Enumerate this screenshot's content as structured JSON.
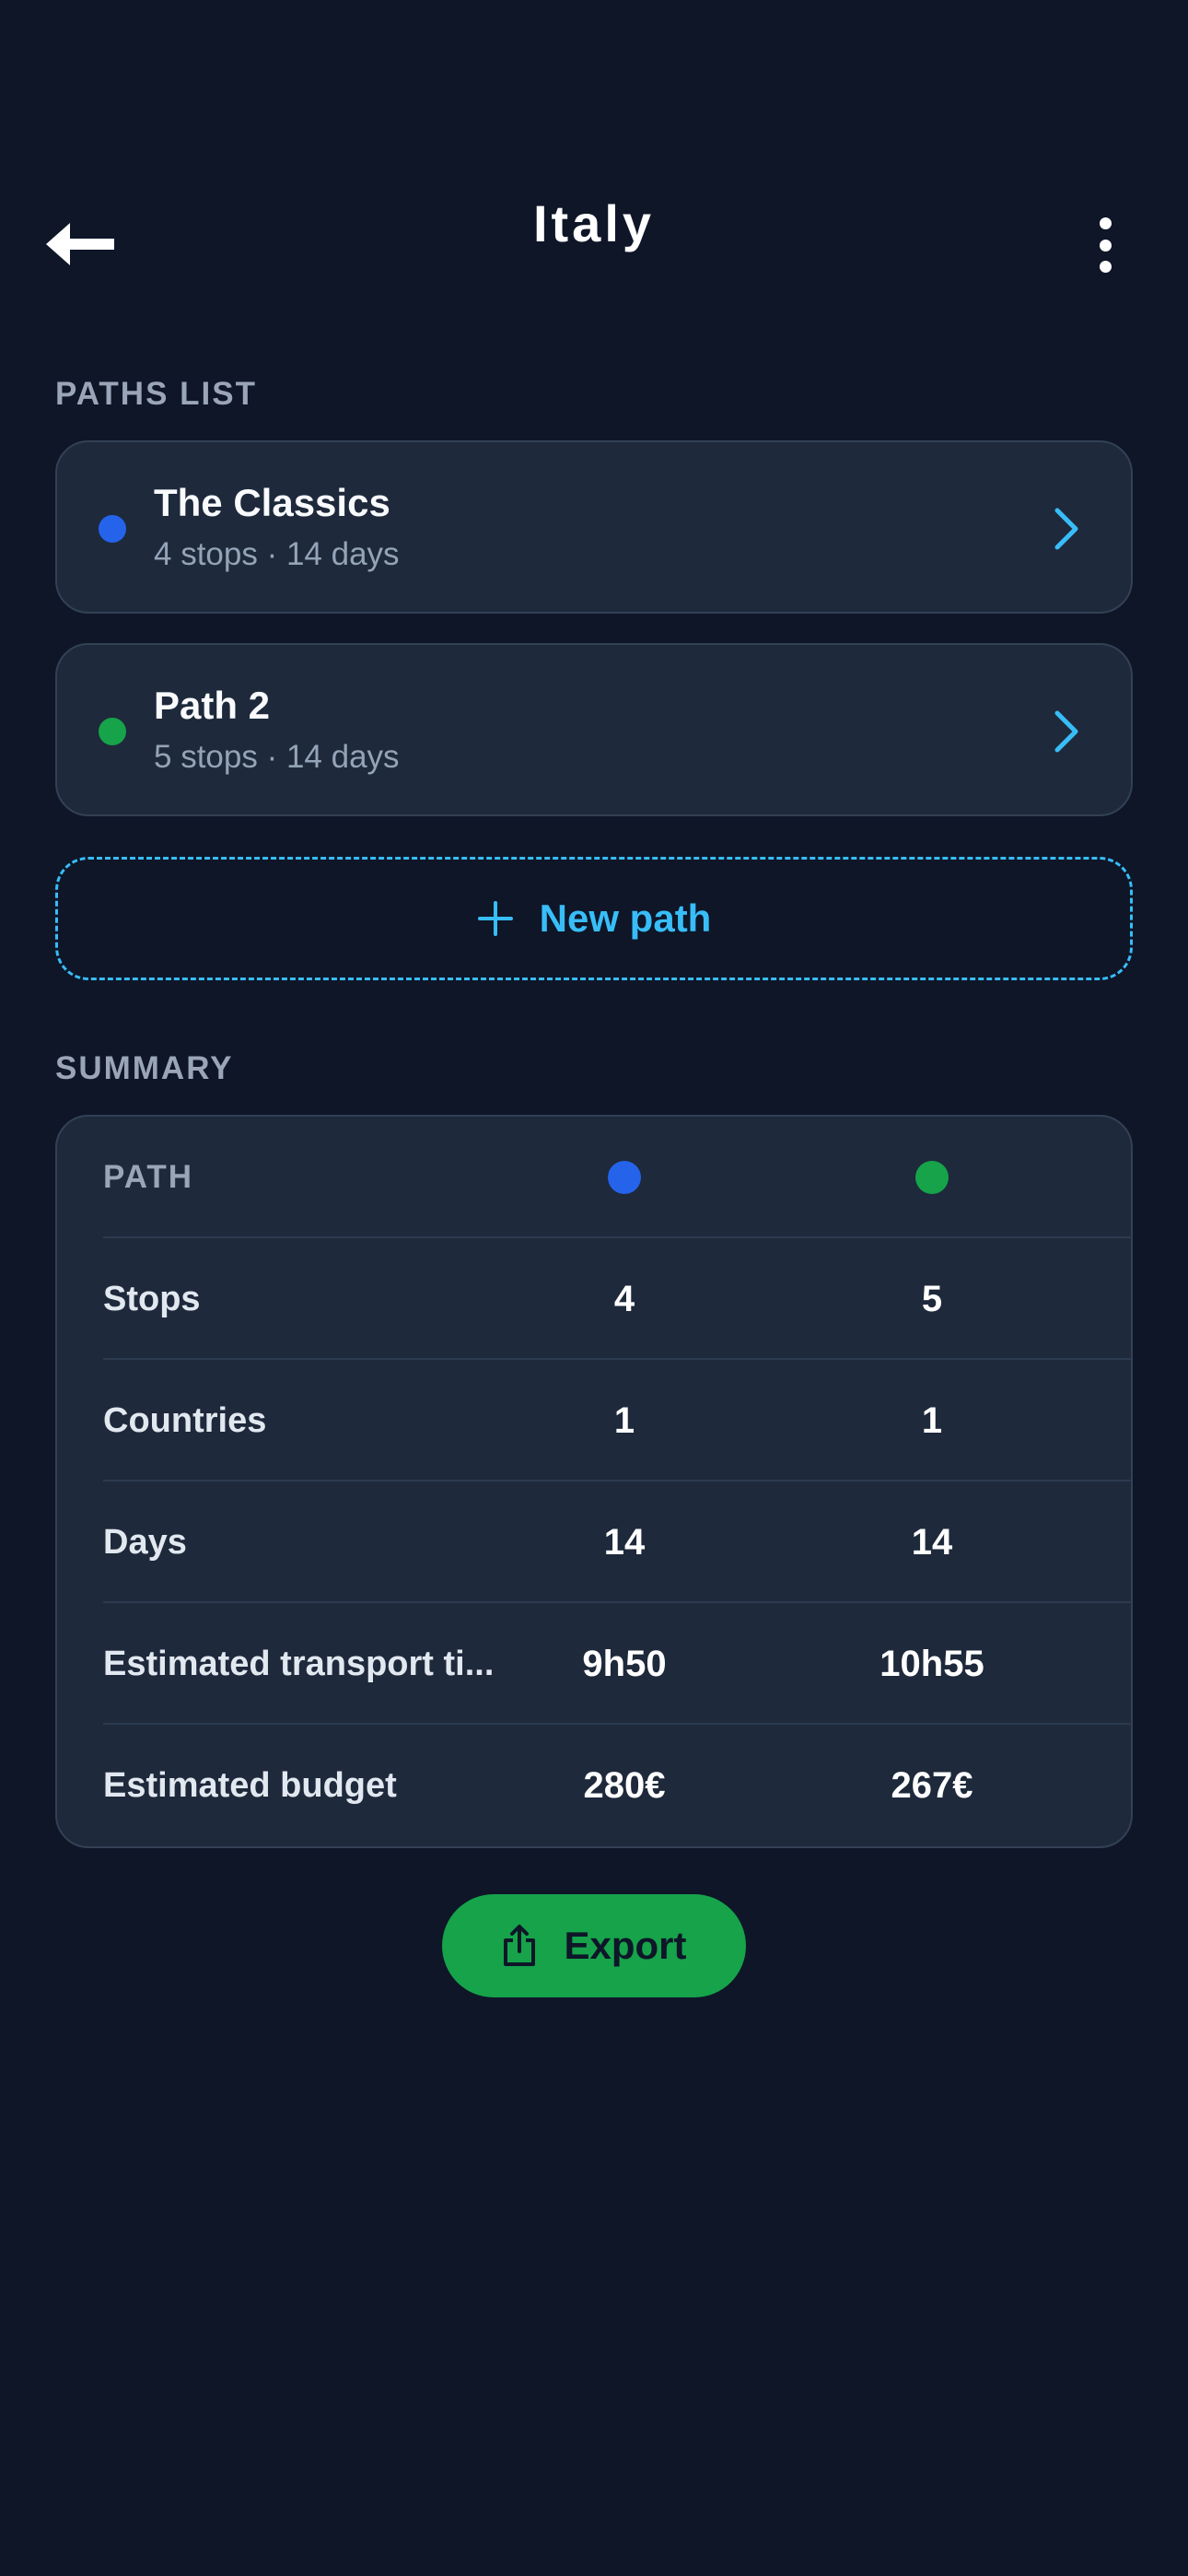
{
  "header": {
    "title": "Italy",
    "back_icon": "arrow-left-icon",
    "menu_icon": "more-vertical-icon"
  },
  "paths_list": {
    "label": "PATHS LIST",
    "items": [
      {
        "name": "The Classics",
        "meta": "4 stops · 14 days",
        "color": "#2563eb"
      },
      {
        "name": "Path 2",
        "meta": "5 stops · 14 days",
        "color": "#16a34a"
      }
    ],
    "new_path_label": "New path"
  },
  "summary": {
    "label": "SUMMARY",
    "header_label": "PATH",
    "path_colors": [
      "#2563eb",
      "#16a34a"
    ],
    "rows": [
      {
        "label": "Stops",
        "values": [
          "4",
          "5"
        ]
      },
      {
        "label": "Countries",
        "values": [
          "1",
          "1"
        ]
      },
      {
        "label": "Days",
        "values": [
          "14",
          "14"
        ]
      },
      {
        "label": "Estimated transport ti...",
        "values": [
          "9h50",
          "10h55"
        ]
      },
      {
        "label": "Estimated budget",
        "values": [
          "280€",
          "267€"
        ]
      }
    ]
  },
  "export": {
    "label": "Export",
    "icon": "share-icon"
  },
  "colors": {
    "background": "#0e1628",
    "card": "#1e293b",
    "accent_blue": "#38bdf8",
    "accent_green": "#16a34a"
  }
}
